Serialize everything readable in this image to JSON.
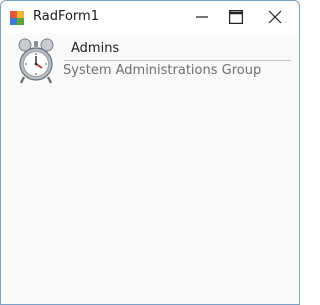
{
  "window": {
    "title": "RadForm1",
    "controls": {
      "minimize_icon": "minimize-icon",
      "maximize_icon": "maximize-icon",
      "close_icon": "close-icon"
    }
  },
  "list": {
    "items": [
      {
        "name": "Admins",
        "description": "System Administrations Group",
        "icon": "alarm-clock-icon"
      }
    ]
  },
  "colors": {
    "window_border": "#7aa0c4",
    "client_background": "#fafafa",
    "description_text": "#6e6e6e",
    "separator": "#c8c8c8"
  }
}
